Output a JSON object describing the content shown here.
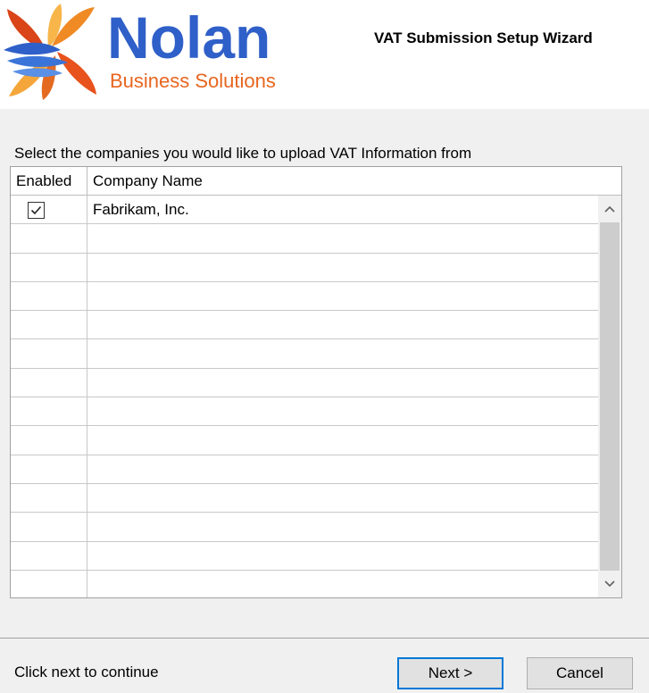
{
  "header": {
    "logo_name": "Nolan",
    "logo_subtitle": "Business Solutions",
    "wizard_title": "VAT Submission Setup Wizard"
  },
  "main": {
    "instruction": "Select the companies you would like to upload VAT Information from",
    "grid": {
      "columns": [
        "Enabled",
        "Company Name"
      ],
      "rows": [
        {
          "enabled": true,
          "company_name": "Fabrikam, Inc."
        },
        {
          "enabled": null,
          "company_name": ""
        },
        {
          "enabled": null,
          "company_name": ""
        },
        {
          "enabled": null,
          "company_name": ""
        },
        {
          "enabled": null,
          "company_name": ""
        },
        {
          "enabled": null,
          "company_name": ""
        },
        {
          "enabled": null,
          "company_name": ""
        },
        {
          "enabled": null,
          "company_name": ""
        },
        {
          "enabled": null,
          "company_name": ""
        },
        {
          "enabled": null,
          "company_name": ""
        },
        {
          "enabled": null,
          "company_name": ""
        },
        {
          "enabled": null,
          "company_name": ""
        },
        {
          "enabled": null,
          "company_name": ""
        },
        {
          "enabled": null,
          "company_name": ""
        }
      ]
    }
  },
  "footer": {
    "hint": "Click next to continue",
    "next_label": "Next >",
    "cancel_label": "Cancel"
  },
  "colors": {
    "logo_blue": "#2f5fc8",
    "logo_orange": "#e8651f",
    "focus_border": "#0078d7"
  },
  "icons": [
    "nolan-pinwheel-logo-icon",
    "checkmark-icon",
    "chevron-up-icon",
    "chevron-down-icon"
  ]
}
